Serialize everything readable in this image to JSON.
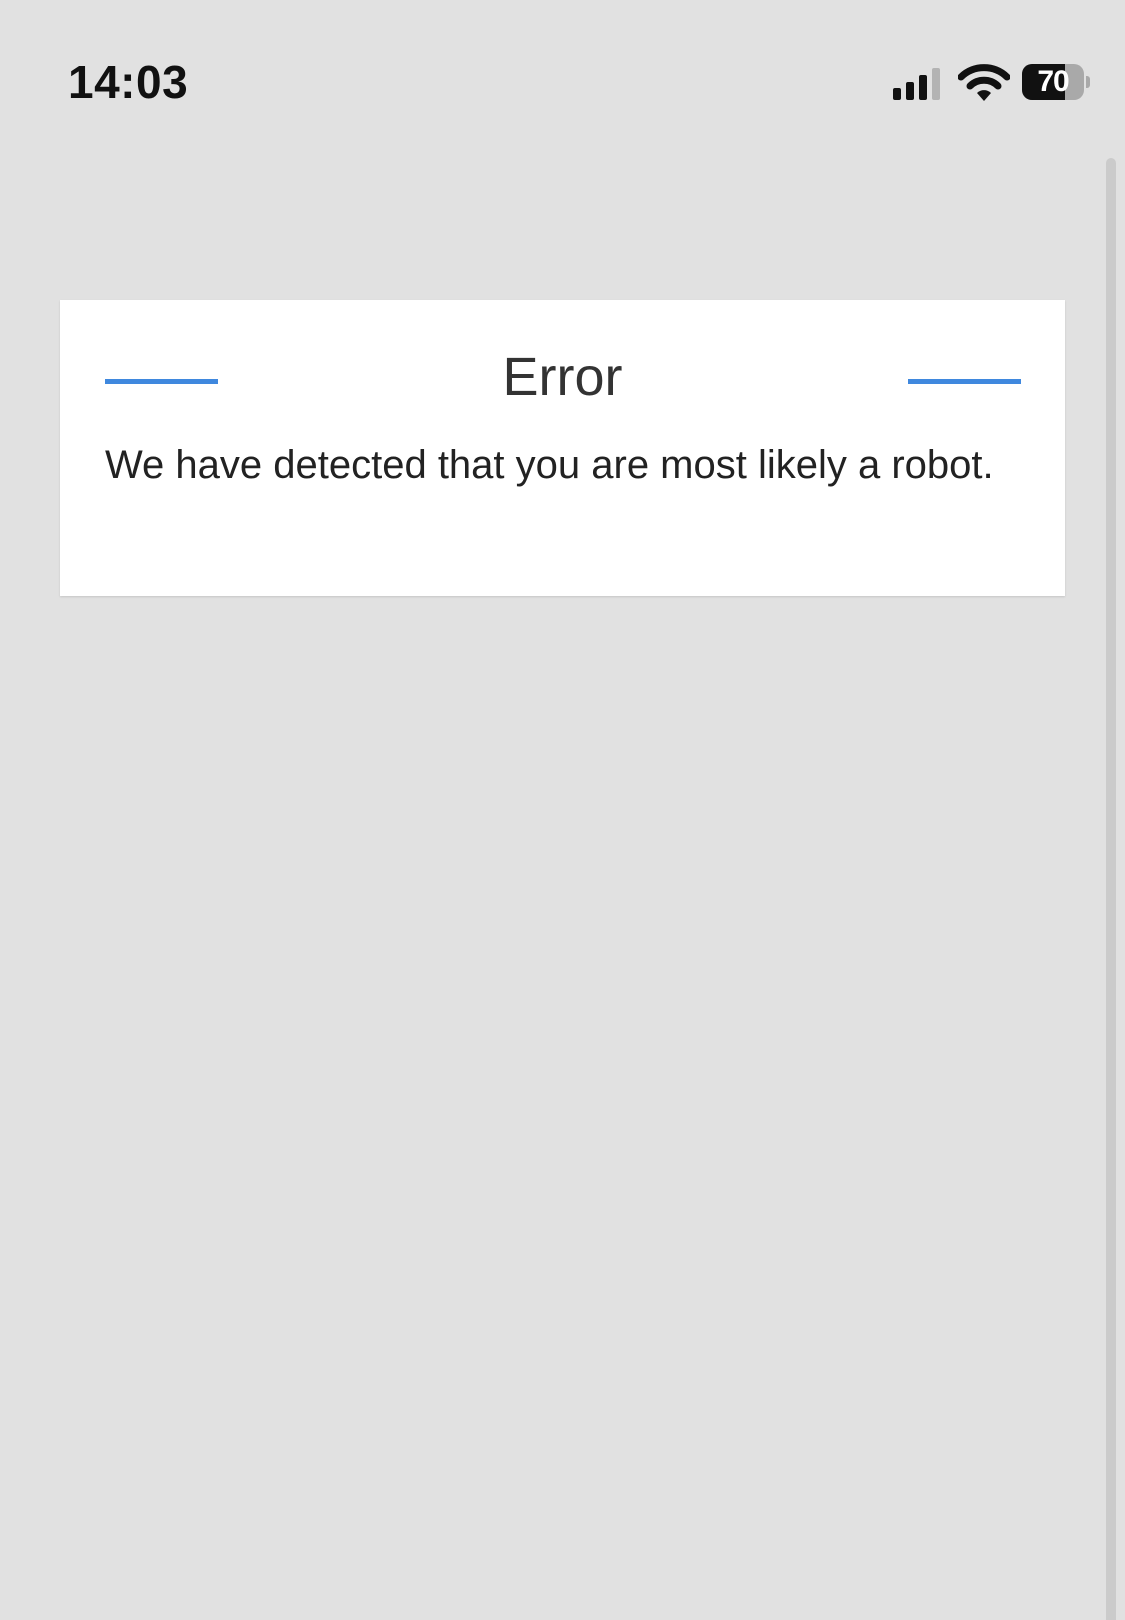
{
  "status_bar": {
    "time": "14:03",
    "signal_icon": "cellular-signal-icon",
    "signal_bars_active": 3,
    "signal_bars_total": 4,
    "wifi_icon": "wifi-icon",
    "battery_icon": "battery-icon",
    "battery_level": "70",
    "battery_fraction": 0.7
  },
  "error_card": {
    "title": "Error",
    "message": "We have detected that you are most likely a robot.",
    "accent_color": "#3f88de"
  }
}
